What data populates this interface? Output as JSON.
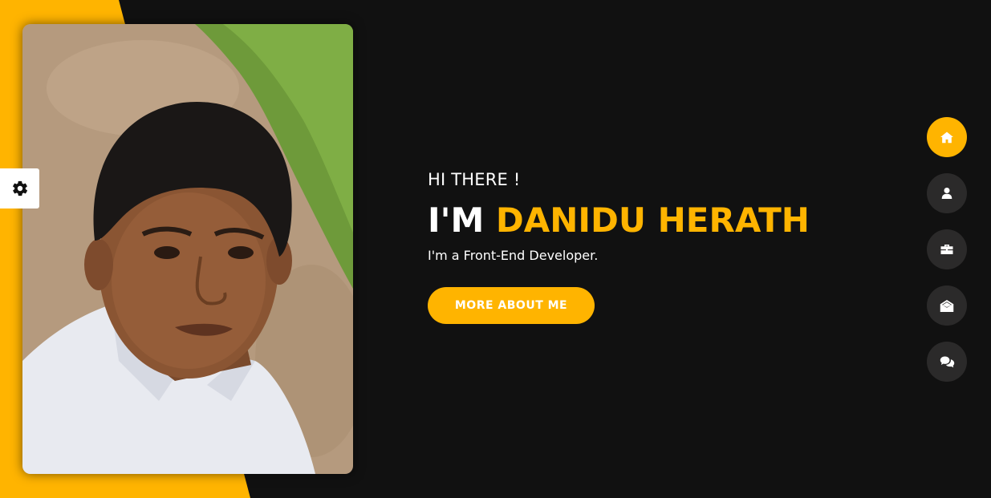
{
  "colors": {
    "accent": "#ffb400",
    "background": "#111111",
    "nav_button_bg": "#2b2a2a",
    "text": "#ffffff"
  },
  "settings": {
    "icon": "gear-icon"
  },
  "hero": {
    "greeting": "HI THERE !",
    "headline_prefix": "I'M ",
    "headline_name": "DANIDU HERATH",
    "tagline": "I'm a Front-End Developer.",
    "cta_label": "MORE ABOUT ME"
  },
  "side_nav": {
    "items": [
      {
        "icon": "home-icon",
        "active": true
      },
      {
        "icon": "user-icon",
        "active": false
      },
      {
        "icon": "briefcase-icon",
        "active": false
      },
      {
        "icon": "envelope-open-icon",
        "active": false
      },
      {
        "icon": "comments-icon",
        "active": false
      }
    ]
  }
}
